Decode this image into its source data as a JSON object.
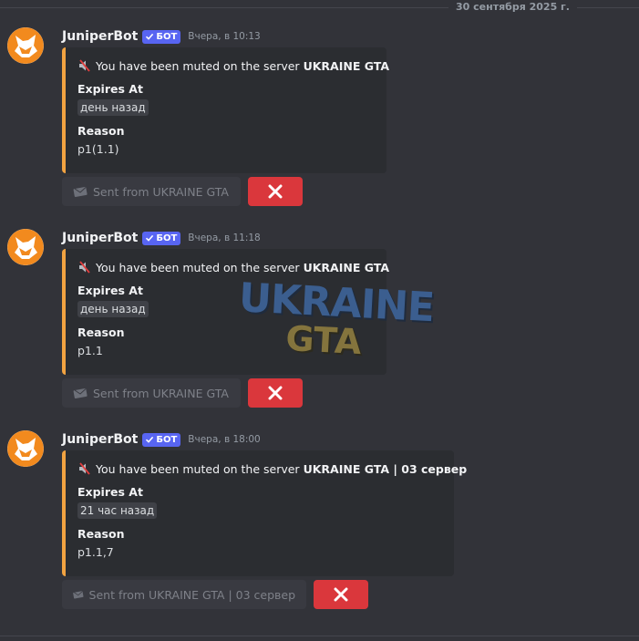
{
  "date_divider": "30 сентября 2025 г.",
  "bot_badge": "БОТ",
  "watermark": {
    "line1": "UKRAINE",
    "line2": "GTA"
  },
  "colors": {
    "embed_accent": "#f2a341",
    "bot_badge": "#5865f2",
    "dismiss_button": "#da373c",
    "avatar_fox": "#f28a1e"
  },
  "icons": {
    "avatar": "fox-logo",
    "badge": "checkmark-icon",
    "title": "muted-speaker-icon",
    "sent": "envelope-icon",
    "dismiss": "close-icon"
  },
  "messages": [
    {
      "username": "JuniperBot",
      "timestamp": "Вчера, в 10:13",
      "embed": {
        "title_prefix": "You have been muted on the server",
        "server": "UKRAINE GTA",
        "expires_label": "Expires At",
        "expires_value": "день назад",
        "reason_label": "Reason",
        "reason_value": "p1(1.1)"
      },
      "sent_from": "Sent from UKRAINE GTA"
    },
    {
      "username": "JuniperBot",
      "timestamp": "Вчера, в 11:18",
      "embed": {
        "title_prefix": "You have been muted on the server",
        "server": "UKRAINE GTA",
        "expires_label": "Expires At",
        "expires_value": "день назад",
        "reason_label": "Reason",
        "reason_value": "p1.1"
      },
      "sent_from": "Sent from UKRAINE GTA"
    },
    {
      "username": "JuniperBot",
      "timestamp": "Вчера, в 18:00",
      "embed": {
        "title_prefix": "You have been muted on the server",
        "server": "UKRAINE GTA | 03 сервер",
        "expires_label": "Expires At",
        "expires_value": "21 час назад",
        "reason_label": "Reason",
        "reason_value": "p1.1,7"
      },
      "sent_from": "Sent from UKRAINE GTA | 03 сервер"
    }
  ]
}
